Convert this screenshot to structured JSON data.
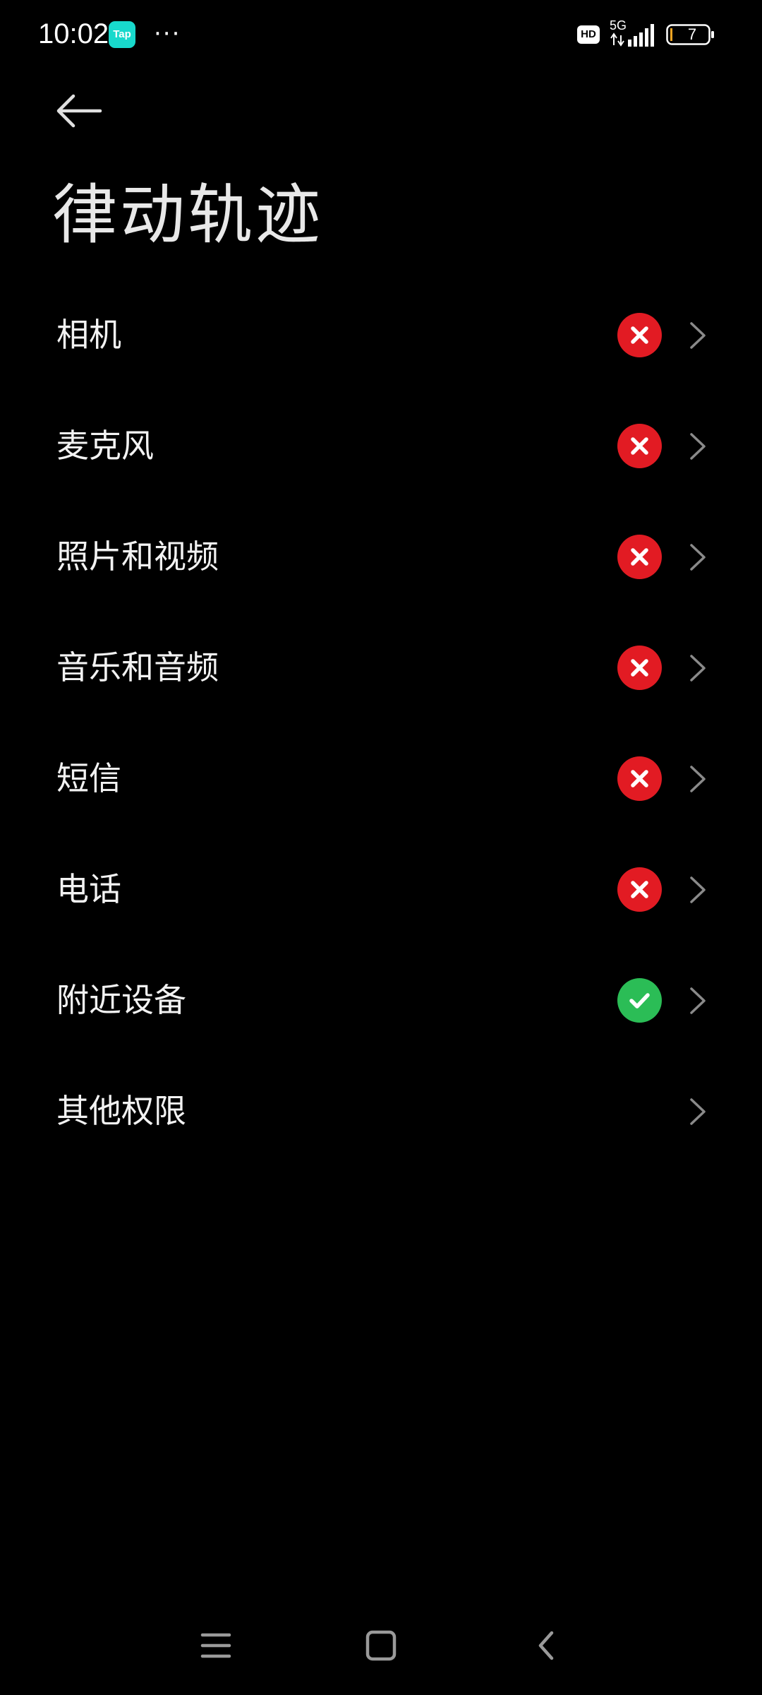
{
  "status_bar": {
    "time": "10:02",
    "app_badge": "Tap",
    "more": "···",
    "hd": "HD",
    "network": "5G",
    "battery": "7"
  },
  "header": {
    "title": "律动轨迹"
  },
  "permissions": [
    {
      "label": "相机",
      "status": "denied"
    },
    {
      "label": "麦克风",
      "status": "denied"
    },
    {
      "label": "照片和视频",
      "status": "denied"
    },
    {
      "label": "音乐和音频",
      "status": "denied"
    },
    {
      "label": "短信",
      "status": "denied"
    },
    {
      "label": "电话",
      "status": "denied"
    },
    {
      "label": "附近设备",
      "status": "allowed"
    },
    {
      "label": "其他权限",
      "status": "none"
    }
  ],
  "colors": {
    "background": "#000000",
    "denied": "#e21b23",
    "allowed": "#2bbd56",
    "tap_badge": "#18d9cc"
  },
  "icons": {
    "denied": "x-mark-icon",
    "allowed": "check-mark-icon",
    "row_action": "chevron-right-icon",
    "back": "back-arrow-icon",
    "nav": [
      "menu-icon",
      "home-icon",
      "back-icon"
    ]
  }
}
